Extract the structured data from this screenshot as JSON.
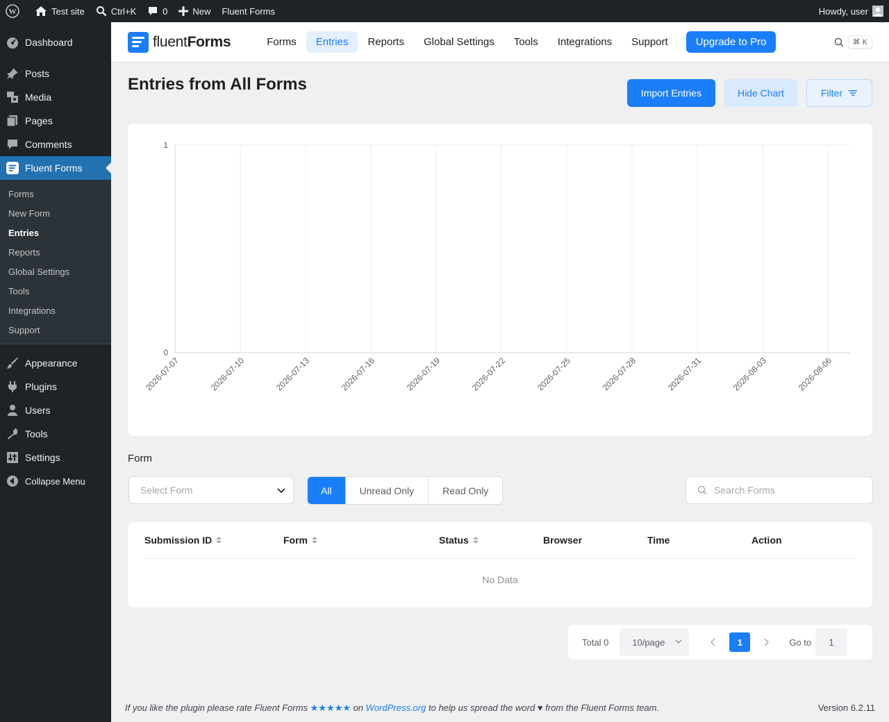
{
  "adminbar": {
    "site_name": "Test site",
    "shortcut": "Ctrl+K",
    "comments_count": "0",
    "new_label": "New",
    "plugin_link": "Fluent Forms",
    "howdy": "Howdy, user"
  },
  "menu": {
    "dashboard": "Dashboard",
    "posts": "Posts",
    "media": "Media",
    "pages": "Pages",
    "comments": "Comments",
    "fluent_forms": "Fluent Forms",
    "submenu": [
      "Forms",
      "New Form",
      "Entries",
      "Reports",
      "Global Settings",
      "Tools",
      "Integrations",
      "Support"
    ],
    "appearance": "Appearance",
    "plugins": "Plugins",
    "users": "Users",
    "tools": "Tools",
    "settings": "Settings",
    "collapse": "Collapse Menu"
  },
  "ff_nav": {
    "logo_light": "fluent",
    "logo_bold": "Forms",
    "links": [
      "Forms",
      "Entries",
      "Reports",
      "Global Settings",
      "Tools",
      "Integrations",
      "Support"
    ],
    "active": "Entries",
    "upgrade": "Upgrade to Pro",
    "search_shortcut": "⌘ K"
  },
  "page": {
    "title": "Entries from All Forms",
    "import_btn": "Import Entries",
    "hide_chart_btn": "Hide Chart",
    "filter_btn": "Filter"
  },
  "chart_data": {
    "type": "line",
    "x": [
      "2026-07-07",
      "2026-07-10",
      "2026-07-13",
      "2026-07-16",
      "2026-07-19",
      "2026-07-22",
      "2026-07-25",
      "2026-07-28",
      "2026-07-31",
      "2026-08-03",
      "2026-08-06"
    ],
    "y_ticks": [
      "0",
      "1"
    ],
    "ylim": [
      0,
      1
    ],
    "series": [],
    "grid": true
  },
  "filters": {
    "form_label": "Form",
    "select_placeholder": "Select Form",
    "segments": [
      "All",
      "Unread Only",
      "Read Only"
    ],
    "active_segment": "All",
    "search_placeholder": "Search Forms"
  },
  "table": {
    "columns": [
      "Submission ID",
      "Form",
      "Status",
      "Browser",
      "Time",
      "Action"
    ],
    "empty": "No Data"
  },
  "pagination": {
    "total": "Total 0",
    "page_size": "10/page",
    "current_page": "1",
    "goto_label": "Go to",
    "goto_value": "1"
  },
  "footer": {
    "text_before": "If you like the plugin please rate Fluent Forms",
    "stars": "★★★★★",
    "text_on": "on",
    "link": "WordPress.org",
    "text_after": "to help us spread the word ♥ from the Fluent Forms team.",
    "version": "Version 6.2.11"
  },
  "colors": {
    "accent": "#1a7efb",
    "wp_admin_bar": "#1d2327",
    "wp_menu_current": "#2271b1"
  }
}
